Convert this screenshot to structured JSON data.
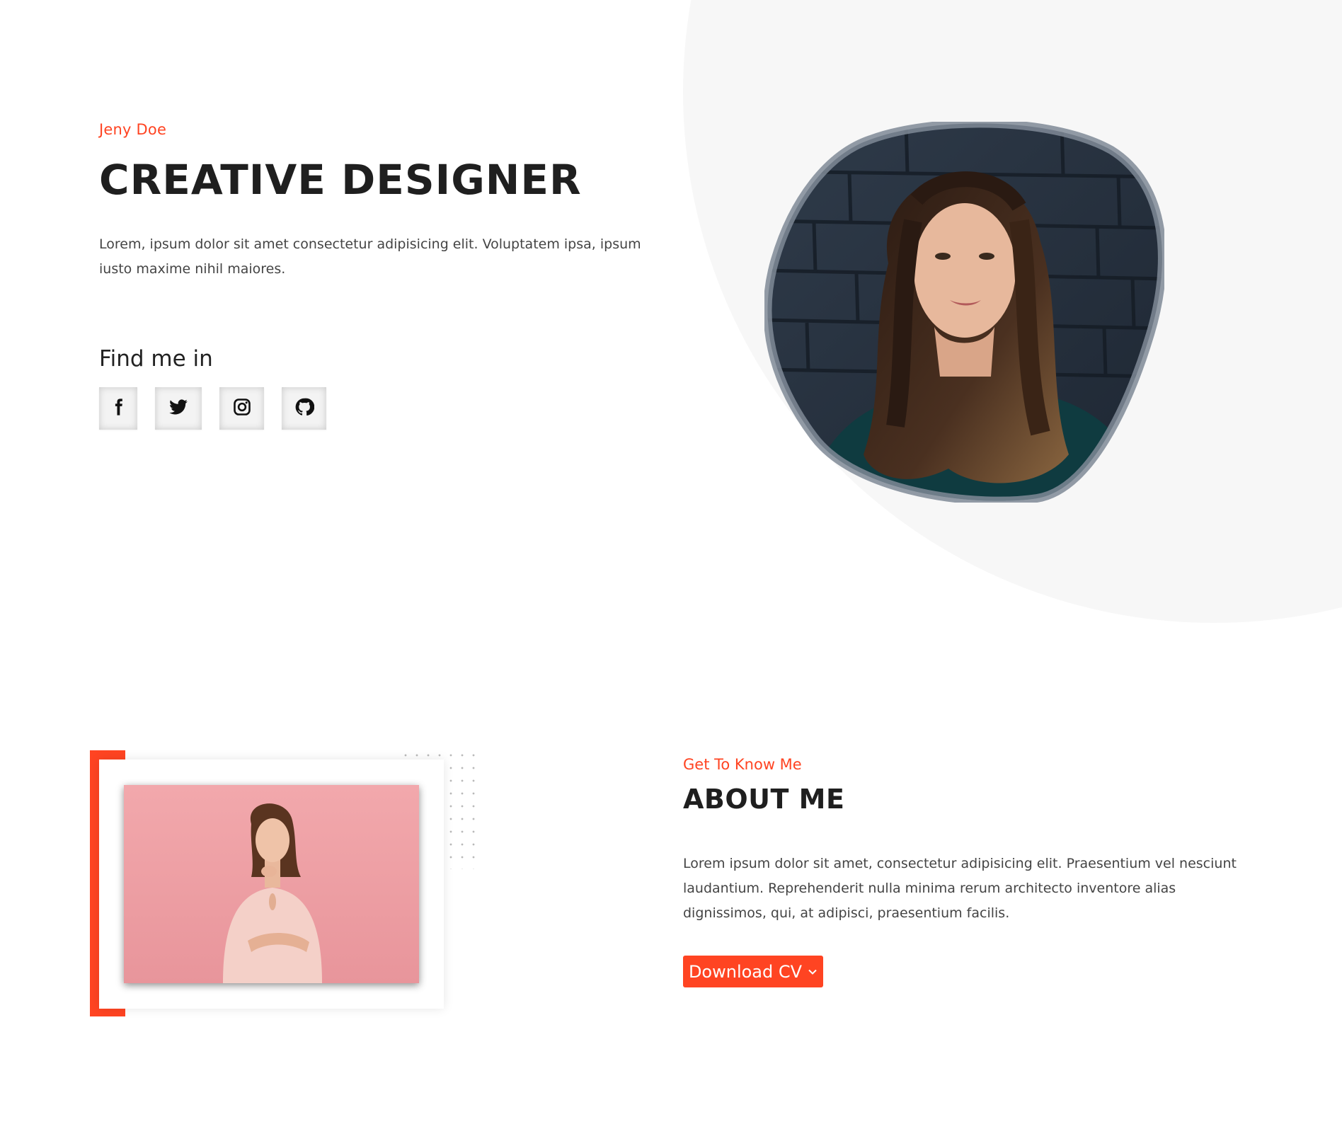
{
  "hero": {
    "name": "Jeny Doe",
    "title": "CREATIVE DESIGNER",
    "description": "Lorem, ipsum dolor sit amet consectetur adipisicing elit. Voluptatem ipsa, ipsum iusto maxime nihil maiores.",
    "find_me_title": "Find me in",
    "social": [
      {
        "icon": "facebook-icon"
      },
      {
        "icon": "twitter-icon"
      },
      {
        "icon": "instagram-icon"
      },
      {
        "icon": "github-icon"
      }
    ]
  },
  "about": {
    "subtitle": "Get To Know Me",
    "title": "ABOUT ME",
    "description": "Lorem ipsum dolor sit amet, consectetur adipisicing elit. Praesentium vel nesciunt laudantium. Reprehenderit nulla minima rerum architecto inventore alias dignissimos, qui, at adipisci, praesentium facilis.",
    "button_label": "Download CV",
    "button_icon": "chevron-down-icon"
  },
  "colors": {
    "accent": "#ff4422",
    "heading": "#1f1f1f",
    "body_text": "#444444",
    "hero_bg": "#f7f7f7"
  }
}
